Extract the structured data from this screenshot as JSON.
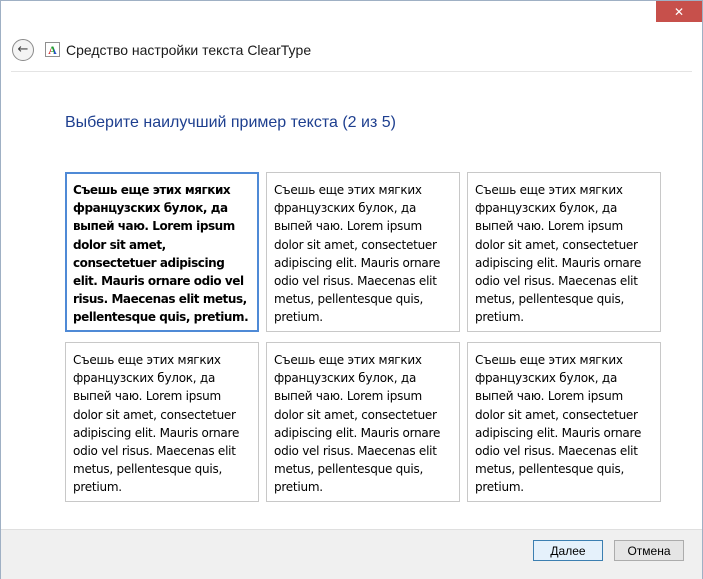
{
  "window": {
    "title": "Средство настройки текста ClearType",
    "close_glyph": "✕"
  },
  "header": {
    "back_glyph": "←",
    "icon_letter": "A"
  },
  "instruction": "Выберите наилучший пример текста (2 из 5)",
  "samples": [
    {
      "text": "Съешь еще этих мягких французских булок, да выпей чаю. Lorem ipsum dolor sit amet, consectetuer adipiscing elit. Mauris ornare odio vel risus. Maecenas elit metus, pellentesque quis, pretium.",
      "selected": true
    },
    {
      "text": "Съешь еще этих мягких французских булок, да выпей чаю. Lorem ipsum dolor sit amet, consectetuer adipiscing elit. Mauris ornare odio vel risus. Maecenas elit metus, pellentesque quis, pretium.",
      "selected": false
    },
    {
      "text": "Съешь еще этих мягких французских булок, да выпей чаю. Lorem ipsum dolor sit amet, consectetuer adipiscing elit. Mauris ornare odio vel risus. Maecenas elit metus, pellentesque quis, pretium.",
      "selected": false
    },
    {
      "text": "Съешь еще этих мягких французских булок, да выпей чаю. Lorem ipsum dolor sit amet, consectetuer adipiscing elit. Mauris ornare odio vel risus. Maecenas elit metus, pellentesque quis, pretium.",
      "selected": false
    },
    {
      "text": "Съешь еще этих мягких французских булок, да выпей чаю. Lorem ipsum dolor sit amet, consectetuer adipiscing elit. Mauris ornare odio vel risus. Maecenas elit metus, pellentesque quis, pretium.",
      "selected": false
    },
    {
      "text": "Съешь еще этих мягких французских булок, да выпей чаю. Lorem ipsum dolor sit amet, consectetuer adipiscing elit. Mauris ornare odio vel risus. Maecenas elit metus, pellentesque quis, pretium.",
      "selected": false
    }
  ],
  "buttons": {
    "next_label": "Далее",
    "cancel_label": "Отмена"
  },
  "colors": {
    "instruction_text": "#1e3f8f",
    "selection_border": "#4f8ad6",
    "close_button": "#c7504b"
  }
}
